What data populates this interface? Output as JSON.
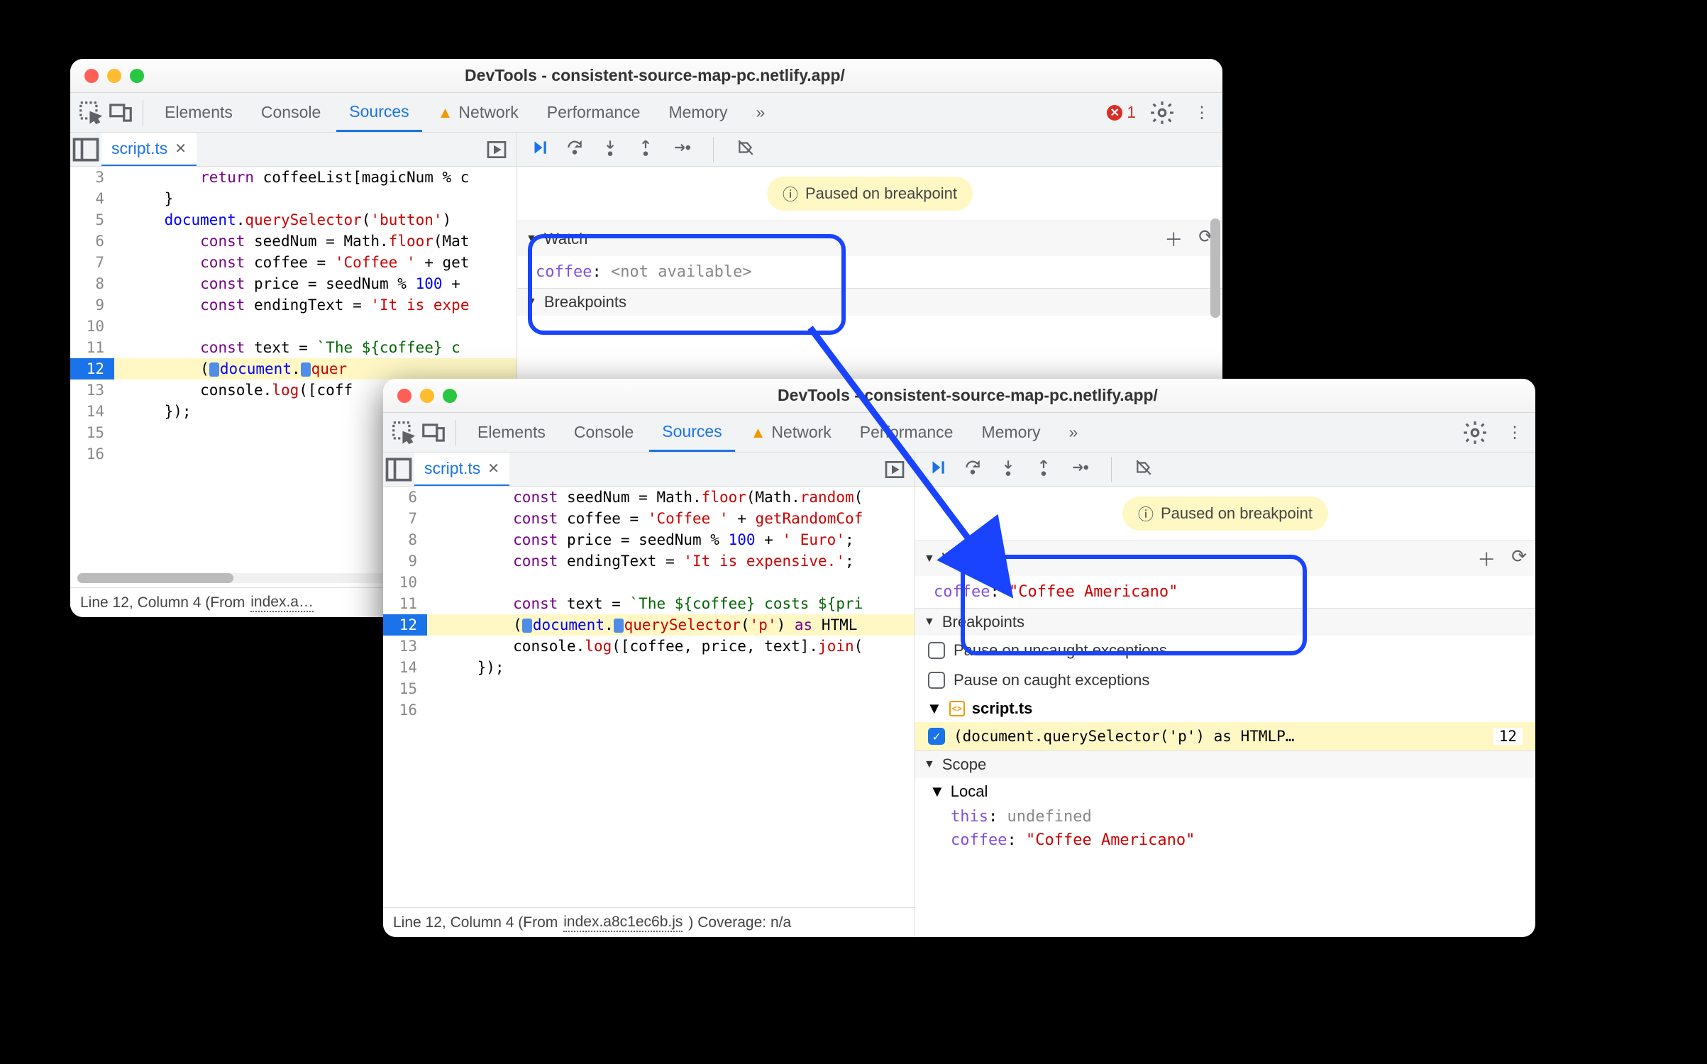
{
  "window_title": "DevTools - consistent-source-map-pc.netlify.app/",
  "tabs": {
    "elements": "Elements",
    "console": "Console",
    "sources": "Sources",
    "network": "Network",
    "performance": "Performance",
    "memory": "Memory",
    "more": "»"
  },
  "error_count": "1",
  "file_tab": "script.ts",
  "paused_msg": "Paused on breakpoint",
  "status_prefix": "Line 12, Column 4  (From ",
  "status_file_w1": "index.a…",
  "status_file_w2": "index.a8c1ec6b.js",
  "status_suffix_w2": ") Coverage: n/a",
  "panes": {
    "watch": "Watch",
    "breakpoints": "Breakpoints",
    "scope": "Scope",
    "local": "Local"
  },
  "watch_var": "coffee",
  "watch_na": "<not available>",
  "watch_val": "\"Coffee Americano\"",
  "pause_uncaught": "Pause on uncaught exceptions",
  "pause_caught": "Pause on caught exceptions",
  "bp_file": "script.ts",
  "bp_text": "(document.querySelector('p') as HTMLP…",
  "bp_line": "12",
  "scope_this": "this",
  "scope_this_val": "undefined",
  "scope_coffee": "coffee",
  "scope_coffee_val": "\"Coffee Americano\"",
  "code_w1": [
    {
      "n": "3",
      "pre": "        ",
      "body": [
        [
          "kw",
          "return"
        ],
        [
          "",
          " coffeeList[magicNum % c"
        ]
      ]
    },
    {
      "n": "4",
      "pre": "    ",
      "body": [
        [
          "",
          "}"
        ]
      ]
    },
    {
      "n": "5",
      "pre": "    ",
      "body": [
        [
          "prop",
          "document"
        ],
        [
          "",
          "."
        ],
        [
          "fn",
          "querySelector"
        ],
        [
          "",
          "("
        ],
        [
          "str",
          "'button'"
        ],
        [
          "",
          ")"
        ]
      ]
    },
    {
      "n": "6",
      "pre": "        ",
      "body": [
        [
          "kw",
          "const"
        ],
        [
          "",
          " seedNum = Math."
        ],
        [
          "fn",
          "floor"
        ],
        [
          "",
          "(Mat"
        ]
      ]
    },
    {
      "n": "7",
      "pre": "        ",
      "body": [
        [
          "kw",
          "const"
        ],
        [
          "",
          " coffee = "
        ],
        [
          "str",
          "'Coffee '"
        ],
        [
          "",
          " + get"
        ]
      ]
    },
    {
      "n": "8",
      "pre": "        ",
      "body": [
        [
          "kw",
          "const"
        ],
        [
          "",
          " price = seedNum % "
        ],
        [
          "num",
          "100"
        ],
        [
          "",
          " + "
        ]
      ]
    },
    {
      "n": "9",
      "pre": "        ",
      "body": [
        [
          "kw",
          "const"
        ],
        [
          "",
          " endingText = "
        ],
        [
          "str",
          "'It is expe"
        ]
      ]
    },
    {
      "n": "10",
      "pre": "",
      "body": [
        [
          "",
          ""
        ]
      ]
    },
    {
      "n": "11",
      "pre": "        ",
      "body": [
        [
          "kw",
          "const"
        ],
        [
          "",
          " text = "
        ],
        [
          "tpl",
          "`The ${coffee} c"
        ]
      ]
    },
    {
      "n": "12",
      "pre": "        ",
      "body": [
        [
          "",
          "("
        ],
        [
          "badge",
          ""
        ],
        [
          "prop",
          "document"
        ],
        [
          "",
          "."
        ],
        [
          "badge",
          ""
        ],
        [
          "fn",
          "quer"
        ]
      ],
      "bp": true,
      "hl": true
    },
    {
      "n": "13",
      "pre": "        ",
      "body": [
        [
          "",
          "console."
        ],
        [
          "fn",
          "log"
        ],
        [
          "",
          "([coff"
        ]
      ]
    },
    {
      "n": "14",
      "pre": "    ",
      "body": [
        [
          "",
          "});"
        ]
      ]
    },
    {
      "n": "15",
      "pre": "",
      "body": [
        [
          "",
          ""
        ]
      ]
    },
    {
      "n": "16",
      "pre": "",
      "body": [
        [
          "",
          ""
        ]
      ]
    }
  ],
  "code_w2": [
    {
      "n": "6",
      "pre": "        ",
      "body": [
        [
          "kw",
          "const"
        ],
        [
          "",
          " seedNum = Math."
        ],
        [
          "fn",
          "floor"
        ],
        [
          "",
          "(Math."
        ],
        [
          "fn",
          "random"
        ],
        [
          "",
          "("
        ]
      ]
    },
    {
      "n": "7",
      "pre": "        ",
      "body": [
        [
          "kw",
          "const"
        ],
        [
          "",
          " coffee = "
        ],
        [
          "str",
          "'Coffee '"
        ],
        [
          "",
          " + "
        ],
        [
          "fn",
          "getRandomCof"
        ]
      ]
    },
    {
      "n": "8",
      "pre": "        ",
      "body": [
        [
          "kw",
          "const"
        ],
        [
          "",
          " price = seedNum % "
        ],
        [
          "num",
          "100"
        ],
        [
          "",
          " + "
        ],
        [
          "str",
          "' Euro'"
        ],
        [
          "",
          ";"
        ]
      ]
    },
    {
      "n": "9",
      "pre": "        ",
      "body": [
        [
          "kw",
          "const"
        ],
        [
          "",
          " endingText = "
        ],
        [
          "str",
          "'It is expensive.'"
        ],
        [
          "",
          ";"
        ]
      ]
    },
    {
      "n": "10",
      "pre": "",
      "body": [
        [
          "",
          ""
        ]
      ]
    },
    {
      "n": "11",
      "pre": "        ",
      "body": [
        [
          "kw",
          "const"
        ],
        [
          "",
          " text = "
        ],
        [
          "tpl",
          "`The ${coffee} costs ${pri"
        ]
      ]
    },
    {
      "n": "12",
      "pre": "        ",
      "body": [
        [
          "",
          "("
        ],
        [
          "badge",
          ""
        ],
        [
          "prop",
          "document"
        ],
        [
          "",
          "."
        ],
        [
          "badge",
          ""
        ],
        [
          "fn",
          "querySelector"
        ],
        [
          "",
          "("
        ],
        [
          "str",
          "'p'"
        ],
        [
          "",
          ") "
        ],
        [
          "kw",
          "as"
        ],
        [
          "",
          " HTML"
        ]
      ],
      "bp": true,
      "hl": true
    },
    {
      "n": "13",
      "pre": "        ",
      "body": [
        [
          "",
          "console."
        ],
        [
          "fn",
          "log"
        ],
        [
          "",
          "([coffee, price, text]."
        ],
        [
          "fn",
          "join"
        ],
        [
          "",
          "("
        ]
      ]
    },
    {
      "n": "14",
      "pre": "    ",
      "body": [
        [
          "",
          "});"
        ]
      ]
    },
    {
      "n": "15",
      "pre": "",
      "body": [
        [
          "",
          ""
        ]
      ]
    },
    {
      "n": "16",
      "pre": "",
      "body": [
        [
          "",
          ""
        ]
      ]
    }
  ]
}
